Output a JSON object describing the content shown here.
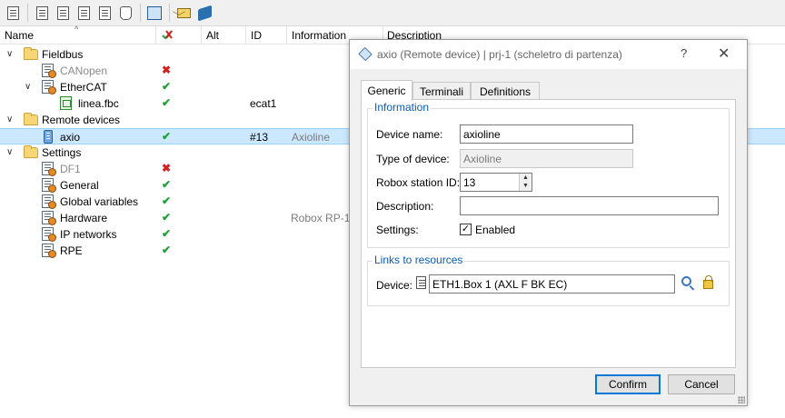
{
  "toolbar": {
    "buttons": [
      "config-icon",
      "page-1-icon",
      "page-2-icon",
      "page-3-icon",
      "page-4-icon",
      "hand-icon",
      "tree-icon",
      "envelope-icon",
      "book-icon"
    ]
  },
  "tree": {
    "columns": {
      "name": "Name",
      "alt": "Alt",
      "id": "ID",
      "information": "Information",
      "description": "Description"
    },
    "rows": [
      {
        "label": "Fieldbus",
        "status": "",
        "id": "",
        "info": ""
      },
      {
        "label": "CANopen",
        "status": "✖",
        "id": "",
        "info": ""
      },
      {
        "label": "EtherCAT",
        "status": "✔",
        "id": "",
        "info": ""
      },
      {
        "label": "linea.fbc",
        "status": "✔",
        "id": "ecat1",
        "info": ""
      },
      {
        "label": "Remote devices",
        "status": "",
        "id": "",
        "info": ""
      },
      {
        "label": "axio",
        "status": "✔",
        "id": "#13",
        "info": "Axioline"
      },
      {
        "label": "Settings",
        "status": "",
        "id": "",
        "info": ""
      },
      {
        "label": "DF1",
        "status": "✖",
        "id": "",
        "info": ""
      },
      {
        "label": "General",
        "status": "✔",
        "id": "",
        "info": ""
      },
      {
        "label": "Global variables",
        "status": "✔",
        "id": "",
        "info": ""
      },
      {
        "label": "Hardware",
        "status": "✔",
        "id": "",
        "info": "Robox RP-1"
      },
      {
        "label": "IP networks",
        "status": "✔",
        "id": "",
        "info": ""
      },
      {
        "label": "RPE",
        "status": "✔",
        "id": "",
        "info": ""
      }
    ]
  },
  "dialog": {
    "title": "axio (Remote device) | prj-1 (scheletro di partenza)",
    "help": "?",
    "close": "✕",
    "tabs": [
      "Generic",
      "Terminali",
      "Definitions"
    ],
    "information": {
      "title": "Information",
      "device_name_label": "Device name:",
      "device_name": "axioline",
      "type_label": "Type of device:",
      "type_value": "Axioline",
      "station_label": "Robox station ID:",
      "station_value": "13",
      "description_label": "Description:",
      "description_value": "",
      "settings_label": "Settings:",
      "enabled_label": "Enabled",
      "enabled_check": "✓"
    },
    "links": {
      "title": "Links to resources",
      "device_label": "Device:",
      "device_value": "ETH1.Box 1 (AXL F BK EC)"
    },
    "confirm": "Confirm",
    "cancel": "Cancel"
  },
  "colors": {
    "ok": "#1f9e3a",
    "error": "#d32020",
    "selection": "#cce8ff",
    "group_title": "#0a5bb5",
    "default_button_border": "#0078d7"
  }
}
